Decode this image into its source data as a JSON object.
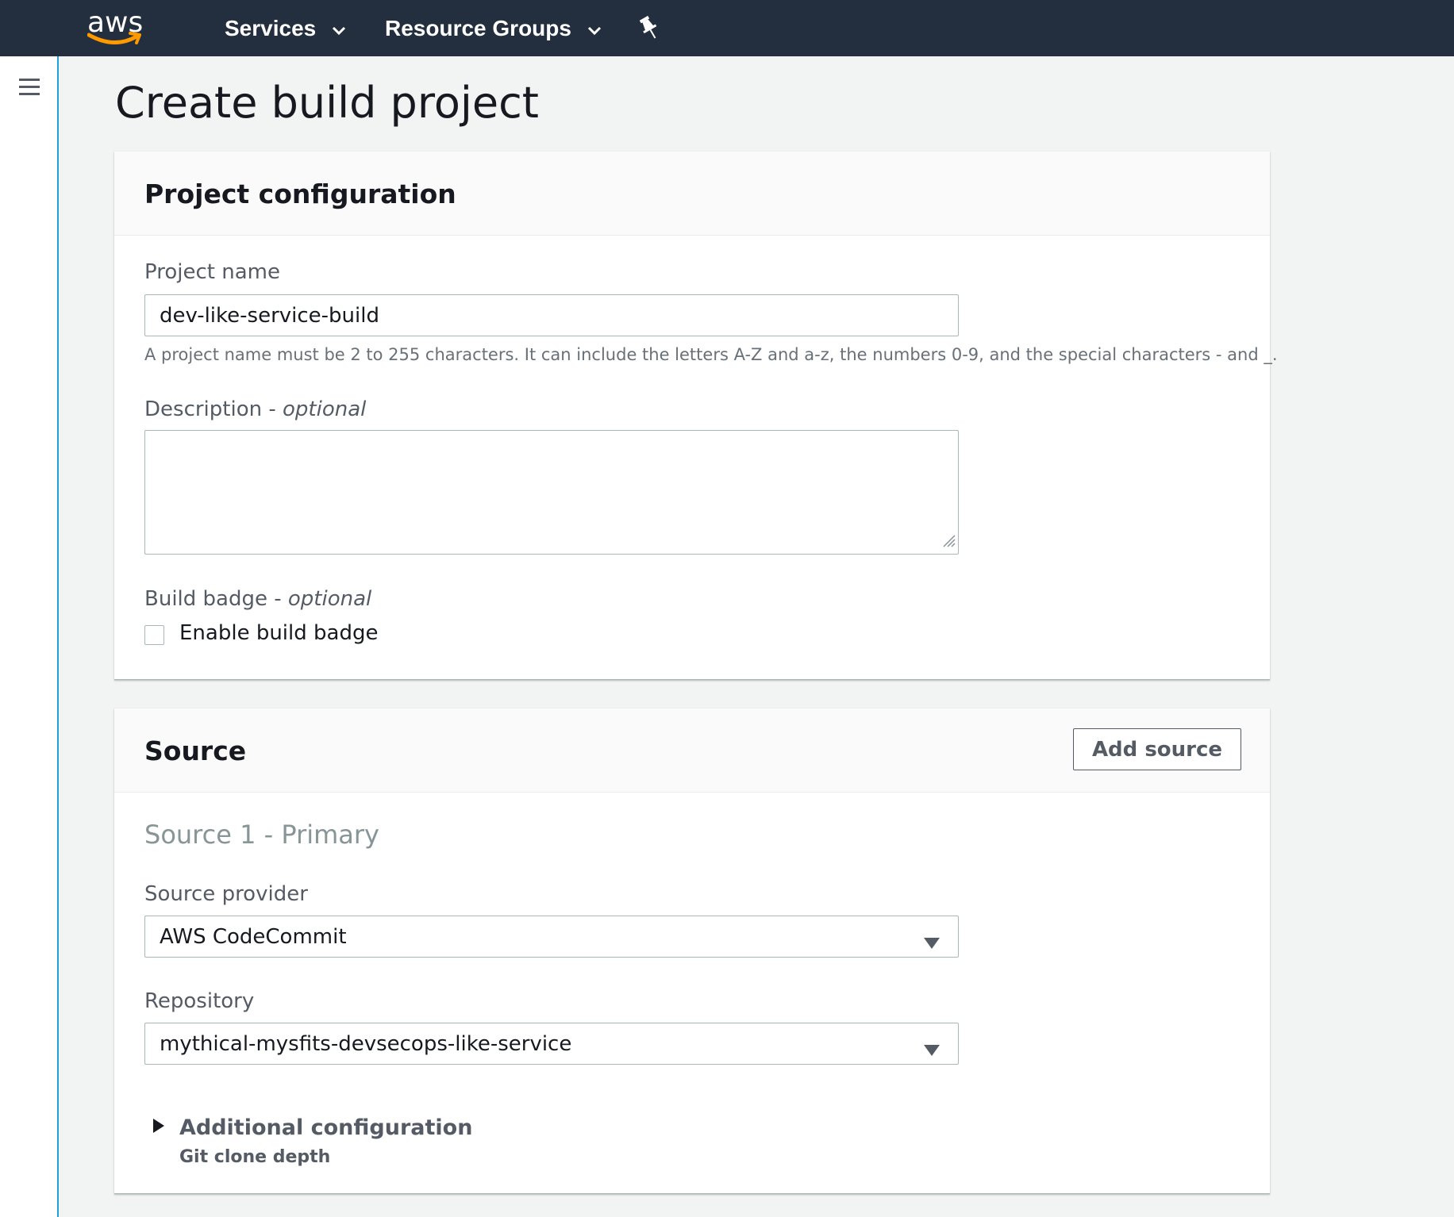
{
  "nav": {
    "logo_text": "aws",
    "services_label": "Services",
    "resource_groups_label": "Resource Groups"
  },
  "page": {
    "title": "Create build project"
  },
  "project_config": {
    "title": "Project configuration",
    "project_name_label": "Project name",
    "project_name_value": "dev-like-service-build",
    "project_name_hint": "A project name must be 2 to 255 characters. It can include the letters A-Z and a-z, the numbers 0-9, and the special characters - and _.",
    "description_label": "Description - ",
    "description_optional": "optional",
    "description_value": "",
    "badge_label": "Build badge - ",
    "badge_optional": "optional",
    "badge_checkbox_label": "Enable build badge",
    "badge_checked": false
  },
  "source": {
    "title": "Source",
    "add_source_label": "Add source",
    "primary_title": "Source 1 - Primary",
    "provider_label": "Source provider",
    "provider_value": "AWS CodeCommit",
    "repository_label": "Repository",
    "repository_value": "mythical-mysfits-devsecops-like-service",
    "additional_config_label": "Additional configuration",
    "additional_config_sub": "Git clone depth"
  },
  "colors": {
    "nav_bg": "#232f3e",
    "logo_smile": "#ff9900",
    "sidebar_accent": "#1ba3dd",
    "page_bg": "#f2f3f3"
  },
  "icons": {
    "logo_smile": "amazon-smile-icon",
    "services_caret": "chevron-down-icon",
    "resource_caret": "chevron-down-icon",
    "pin": "pushpin-icon",
    "menu": "hamburger-menu-icon",
    "select_arrow": "caret-down-icon",
    "expander": "caret-right-icon",
    "resize": "resize-grip-icon"
  }
}
